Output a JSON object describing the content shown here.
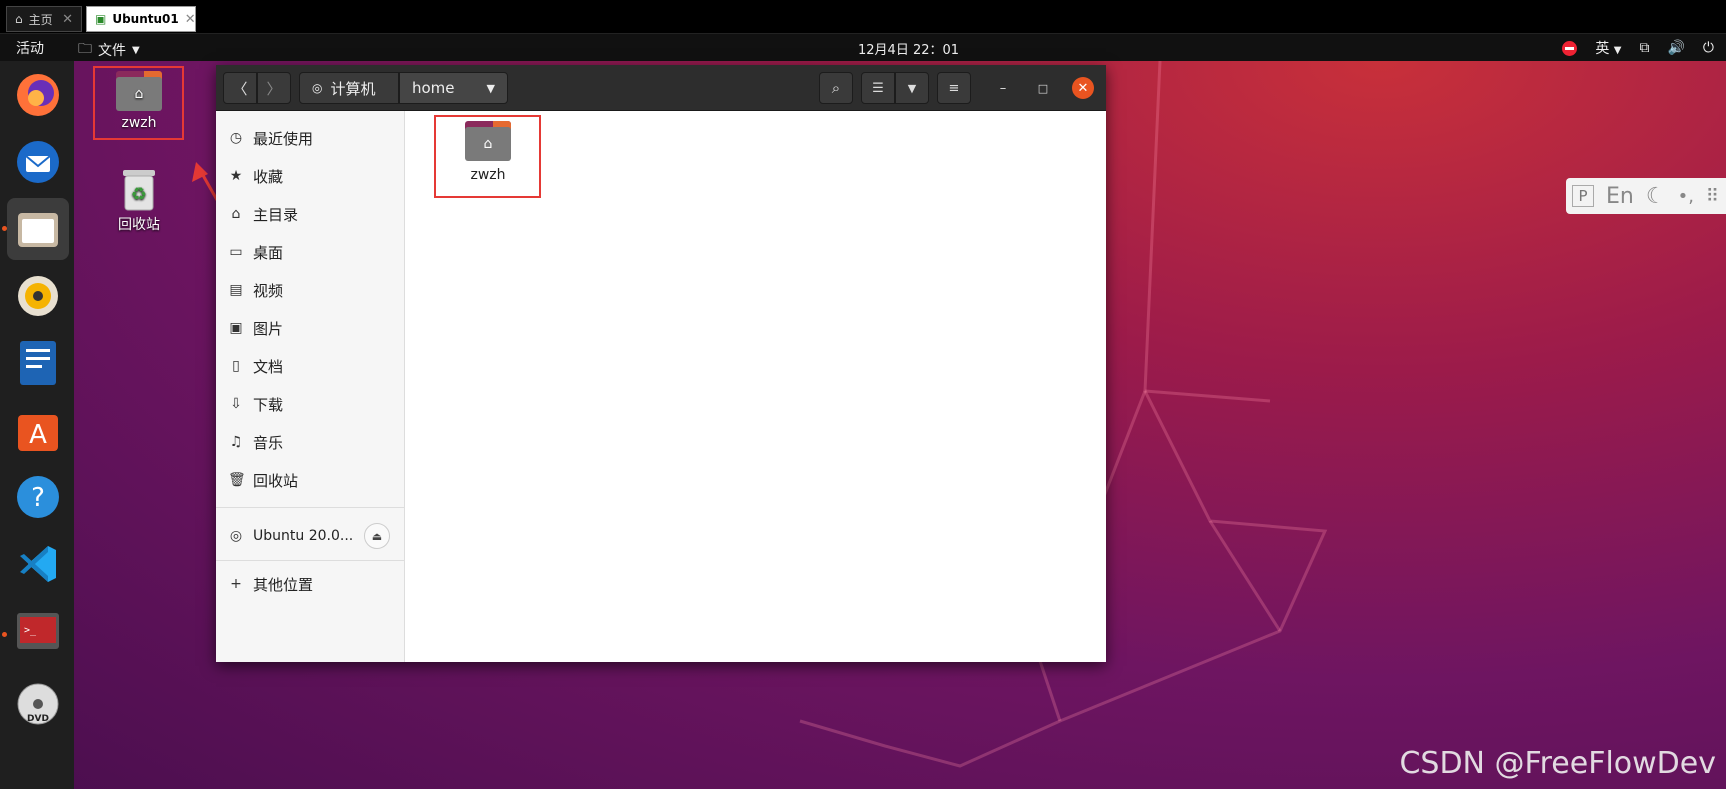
{
  "vm_tabs": [
    {
      "label": "主页"
    },
    {
      "label": "Ubuntu01"
    }
  ],
  "topbar": {
    "activities": "活动",
    "app_menu": "文件",
    "clock": "12月4日  22：01",
    "input_method": "英"
  },
  "desktop_icons": [
    {
      "label": "zwzh"
    },
    {
      "label": "回收站"
    }
  ],
  "window": {
    "path_root": "计算机",
    "path_current": "home",
    "sidebar": [
      {
        "label": "最近使用",
        "icon": "clock-icon"
      },
      {
        "label": "收藏",
        "icon": "star-icon"
      },
      {
        "label": "主目录",
        "icon": "home-icon"
      },
      {
        "label": "桌面",
        "icon": "desktop-icon"
      },
      {
        "label": "视频",
        "icon": "video-icon"
      },
      {
        "label": "图片",
        "icon": "image-icon"
      },
      {
        "label": "文档",
        "icon": "document-icon"
      },
      {
        "label": "下载",
        "icon": "download-icon"
      },
      {
        "label": "音乐",
        "icon": "music-icon"
      },
      {
        "label": "回收站",
        "icon": "trash-icon"
      }
    ],
    "device": "Ubuntu 20.0...",
    "other_locations": "其他位置",
    "folder_label": "zwzh"
  },
  "ime_bar": {
    "p": "P",
    "lang": "En"
  },
  "watermark": "CSDN @FreeFlowDev",
  "colors": {
    "accent": "#e95420",
    "annotation": "#e53935"
  }
}
